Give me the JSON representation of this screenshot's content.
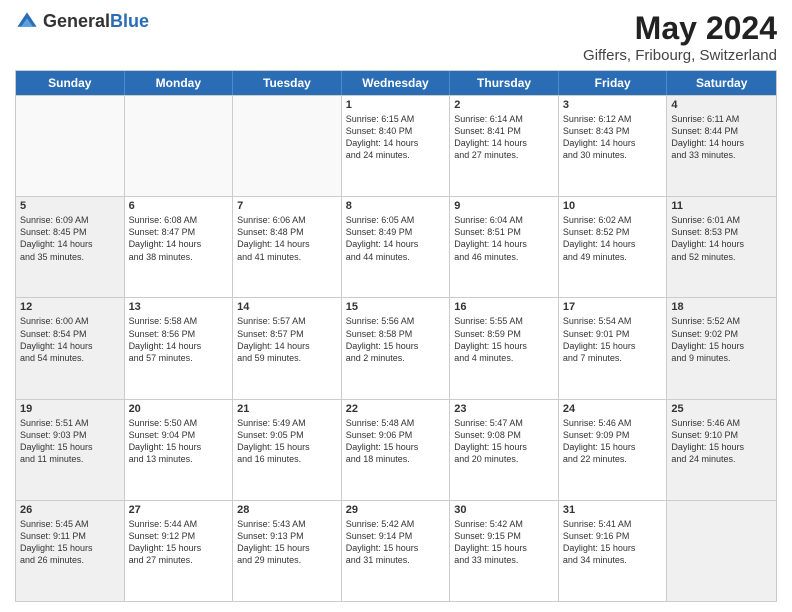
{
  "header": {
    "logo_general": "General",
    "logo_blue": "Blue",
    "title": "May 2024",
    "subtitle": "Giffers, Fribourg, Switzerland"
  },
  "days_of_week": [
    "Sunday",
    "Monday",
    "Tuesday",
    "Wednesday",
    "Thursday",
    "Friday",
    "Saturday"
  ],
  "rows": [
    [
      {
        "day": "",
        "text": "",
        "empty": true
      },
      {
        "day": "",
        "text": "",
        "empty": true
      },
      {
        "day": "",
        "text": "",
        "empty": true
      },
      {
        "day": "1",
        "text": "Sunrise: 6:15 AM\nSunset: 8:40 PM\nDaylight: 14 hours\nand 24 minutes.",
        "empty": false
      },
      {
        "day": "2",
        "text": "Sunrise: 6:14 AM\nSunset: 8:41 PM\nDaylight: 14 hours\nand 27 minutes.",
        "empty": false
      },
      {
        "day": "3",
        "text": "Sunrise: 6:12 AM\nSunset: 8:43 PM\nDaylight: 14 hours\nand 30 minutes.",
        "empty": false
      },
      {
        "day": "4",
        "text": "Sunrise: 6:11 AM\nSunset: 8:44 PM\nDaylight: 14 hours\nand 33 minutes.",
        "empty": false,
        "shaded": true
      }
    ],
    [
      {
        "day": "5",
        "text": "Sunrise: 6:09 AM\nSunset: 8:45 PM\nDaylight: 14 hours\nand 35 minutes.",
        "empty": false,
        "shaded": true
      },
      {
        "day": "6",
        "text": "Sunrise: 6:08 AM\nSunset: 8:47 PM\nDaylight: 14 hours\nand 38 minutes.",
        "empty": false
      },
      {
        "day": "7",
        "text": "Sunrise: 6:06 AM\nSunset: 8:48 PM\nDaylight: 14 hours\nand 41 minutes.",
        "empty": false
      },
      {
        "day": "8",
        "text": "Sunrise: 6:05 AM\nSunset: 8:49 PM\nDaylight: 14 hours\nand 44 minutes.",
        "empty": false
      },
      {
        "day": "9",
        "text": "Sunrise: 6:04 AM\nSunset: 8:51 PM\nDaylight: 14 hours\nand 46 minutes.",
        "empty": false
      },
      {
        "day": "10",
        "text": "Sunrise: 6:02 AM\nSunset: 8:52 PM\nDaylight: 14 hours\nand 49 minutes.",
        "empty": false
      },
      {
        "day": "11",
        "text": "Sunrise: 6:01 AM\nSunset: 8:53 PM\nDaylight: 14 hours\nand 52 minutes.",
        "empty": false,
        "shaded": true
      }
    ],
    [
      {
        "day": "12",
        "text": "Sunrise: 6:00 AM\nSunset: 8:54 PM\nDaylight: 14 hours\nand 54 minutes.",
        "empty": false,
        "shaded": true
      },
      {
        "day": "13",
        "text": "Sunrise: 5:58 AM\nSunset: 8:56 PM\nDaylight: 14 hours\nand 57 minutes.",
        "empty": false
      },
      {
        "day": "14",
        "text": "Sunrise: 5:57 AM\nSunset: 8:57 PM\nDaylight: 14 hours\nand 59 minutes.",
        "empty": false
      },
      {
        "day": "15",
        "text": "Sunrise: 5:56 AM\nSunset: 8:58 PM\nDaylight: 15 hours\nand 2 minutes.",
        "empty": false
      },
      {
        "day": "16",
        "text": "Sunrise: 5:55 AM\nSunset: 8:59 PM\nDaylight: 15 hours\nand 4 minutes.",
        "empty": false
      },
      {
        "day": "17",
        "text": "Sunrise: 5:54 AM\nSunset: 9:01 PM\nDaylight: 15 hours\nand 7 minutes.",
        "empty": false
      },
      {
        "day": "18",
        "text": "Sunrise: 5:52 AM\nSunset: 9:02 PM\nDaylight: 15 hours\nand 9 minutes.",
        "empty": false,
        "shaded": true
      }
    ],
    [
      {
        "day": "19",
        "text": "Sunrise: 5:51 AM\nSunset: 9:03 PM\nDaylight: 15 hours\nand 11 minutes.",
        "empty": false,
        "shaded": true
      },
      {
        "day": "20",
        "text": "Sunrise: 5:50 AM\nSunset: 9:04 PM\nDaylight: 15 hours\nand 13 minutes.",
        "empty": false
      },
      {
        "day": "21",
        "text": "Sunrise: 5:49 AM\nSunset: 9:05 PM\nDaylight: 15 hours\nand 16 minutes.",
        "empty": false
      },
      {
        "day": "22",
        "text": "Sunrise: 5:48 AM\nSunset: 9:06 PM\nDaylight: 15 hours\nand 18 minutes.",
        "empty": false
      },
      {
        "day": "23",
        "text": "Sunrise: 5:47 AM\nSunset: 9:08 PM\nDaylight: 15 hours\nand 20 minutes.",
        "empty": false
      },
      {
        "day": "24",
        "text": "Sunrise: 5:46 AM\nSunset: 9:09 PM\nDaylight: 15 hours\nand 22 minutes.",
        "empty": false
      },
      {
        "day": "25",
        "text": "Sunrise: 5:46 AM\nSunset: 9:10 PM\nDaylight: 15 hours\nand 24 minutes.",
        "empty": false,
        "shaded": true
      }
    ],
    [
      {
        "day": "26",
        "text": "Sunrise: 5:45 AM\nSunset: 9:11 PM\nDaylight: 15 hours\nand 26 minutes.",
        "empty": false,
        "shaded": true
      },
      {
        "day": "27",
        "text": "Sunrise: 5:44 AM\nSunset: 9:12 PM\nDaylight: 15 hours\nand 27 minutes.",
        "empty": false
      },
      {
        "day": "28",
        "text": "Sunrise: 5:43 AM\nSunset: 9:13 PM\nDaylight: 15 hours\nand 29 minutes.",
        "empty": false
      },
      {
        "day": "29",
        "text": "Sunrise: 5:42 AM\nSunset: 9:14 PM\nDaylight: 15 hours\nand 31 minutes.",
        "empty": false
      },
      {
        "day": "30",
        "text": "Sunrise: 5:42 AM\nSunset: 9:15 PM\nDaylight: 15 hours\nand 33 minutes.",
        "empty": false
      },
      {
        "day": "31",
        "text": "Sunrise: 5:41 AM\nSunset: 9:16 PM\nDaylight: 15 hours\nand 34 minutes.",
        "empty": false
      },
      {
        "day": "",
        "text": "",
        "empty": true,
        "shaded": true
      }
    ]
  ]
}
